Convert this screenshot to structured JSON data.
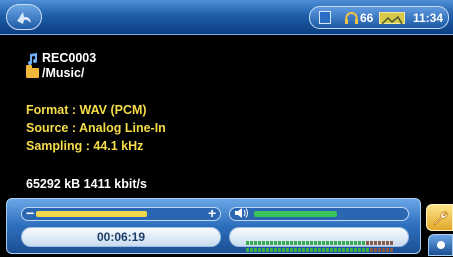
{
  "status": {
    "volume": "66",
    "clock": "11:34"
  },
  "track": {
    "name": "REC0003",
    "folder": "/Music/"
  },
  "details": {
    "format": "Format : WAV (PCM)",
    "source": "Source : Analog Line-In",
    "sampling": "Sampling : 44.1 kHz",
    "size_bitrate": "65292 kB 1411 kbit/s"
  },
  "player": {
    "elapsed": "00:06:19",
    "seek_minus": "−",
    "seek_plus": "+",
    "seek_fraction": 0.66,
    "volume_fraction": 0.55
  },
  "colors": {
    "accent_blue": "#1f5fa8",
    "info_yellow": "#f5dc4a",
    "seek_fill": "#f0d64c",
    "volume_fill": "#39c45a"
  },
  "icons": {
    "back": "back-arrow-icon",
    "storage": "storage-icon",
    "headphones": "headphones-icon",
    "battery": "battery-icon",
    "note": "music-note-icon",
    "folder": "folder-icon",
    "speaker": "speaker-icon",
    "tools": "wrench-icon",
    "dot": "dot-icon"
  }
}
